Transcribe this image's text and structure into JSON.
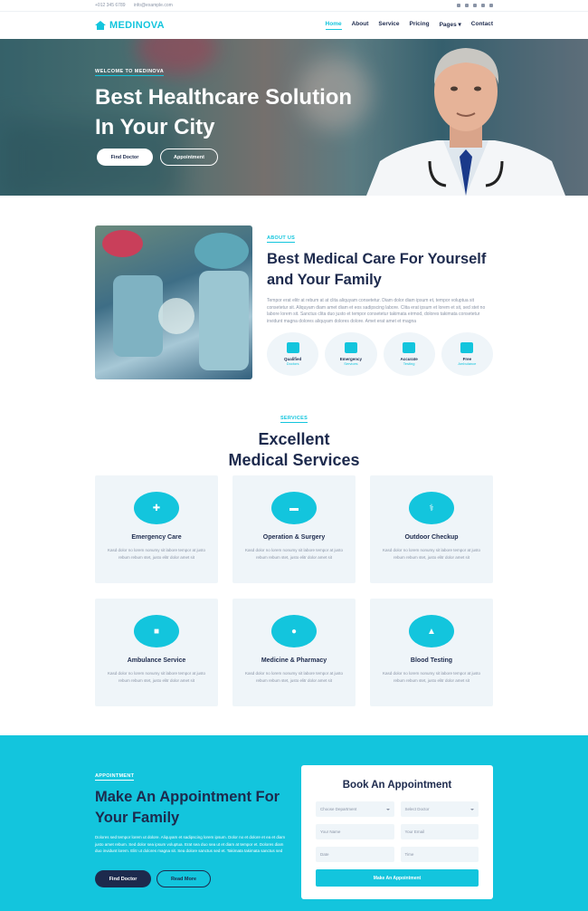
{
  "topbar": {
    "phone": "+012 345 6789",
    "email": "info@example.com",
    "socials": [
      "facebook-icon",
      "twitter-icon",
      "linkedin-icon",
      "instagram-icon",
      "youtube-icon"
    ]
  },
  "brand": {
    "name": "MEDINOVA",
    "color": "#13c5dd"
  },
  "nav": {
    "items": [
      "Home",
      "About",
      "Service",
      "Pricing",
      "Pages ▾",
      "Contact"
    ],
    "active": "Home"
  },
  "hero": {
    "tag": "WELCOME TO MEDINOVA",
    "title": "Best Healthcare Solution In Your City",
    "btn_primary": "Find Doctor",
    "btn_secondary": "Appointment"
  },
  "about": {
    "tag": "ABOUT US",
    "title": "Best Medical Care For Yourself and Your Family",
    "text": "Tempor erat elitr at rebum at at clita aliquyam consetetur. Diam dolor diam ipsum et, tempor voluptua sit consetetur sit. Aliquyam diam amet diam et eos sadipscing labore. Clita erat ipsum et lorem et sit, sed stet no labore lorem sit. Sanctus clita duo justo et tempor consetetur takimata eirmod, dolores takimata consetetur invidunt magna dolores aliquyam dolores dolore. Amet erat amet et magna",
    "features": [
      {
        "title": "Qualified",
        "sub": "Doctors"
      },
      {
        "title": "Emergency",
        "sub": "Services"
      },
      {
        "title": "Accurate",
        "sub": "Testing"
      },
      {
        "title": "Free",
        "sub": "Ambulance"
      }
    ]
  },
  "services": {
    "tag": "SERVICES",
    "title": "Excellent Medical Services",
    "desc": "Kasd dolor no lorem nonumy sit labore tempor at justo rebum rebum stet, justo elitr dolor amet sit",
    "items": [
      {
        "name": "Emergency Care",
        "icon": "first-aid-icon"
      },
      {
        "name": "Operation & Surgery",
        "icon": "procedures-icon"
      },
      {
        "name": "Outdoor Checkup",
        "icon": "stethoscope-icon"
      },
      {
        "name": "Ambulance Service",
        "icon": "ambulance-icon"
      },
      {
        "name": "Medicine & Pharmacy",
        "icon": "pills-icon"
      },
      {
        "name": "Blood Testing",
        "icon": "microscope-icon"
      }
    ]
  },
  "appointment": {
    "tag": "APPOINTMENT",
    "title": "Make An Appointment For Your Family",
    "text": "Dolores sed tempor lorem ut dolore. Aliquyam et sadipscing lorem ipsum. Dolor no et dolore et ea et diam justo amet rebum. Sed dolor sea ipsum voluptua. Erat sea duo sea ut et diam at tempor et. Dolores diam duo invidunt lorem. Elitr ut dolores magna sit. Sea dolore sanctus sed et. Takimata takimata sanctus sed",
    "btn_primary": "Find Doctor",
    "btn_secondary": "Read More",
    "form": {
      "title": "Book An Appointment",
      "department": "Choose Department",
      "doctor": "Select Doctor",
      "name": "Your Name",
      "email": "Your Email",
      "date": "Date",
      "time": "Time",
      "submit": "Make An Appointment"
    }
  }
}
